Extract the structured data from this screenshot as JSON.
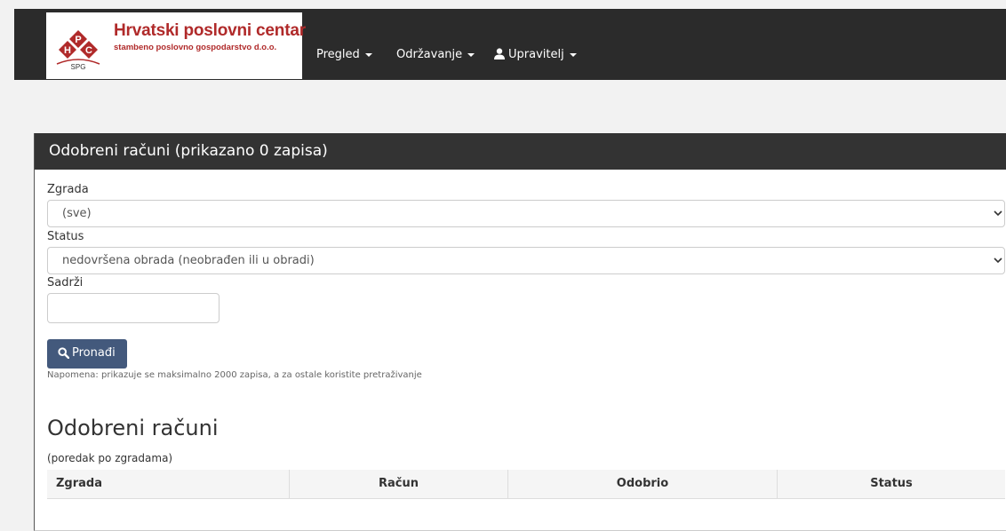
{
  "brand": {
    "logo_letters": [
      "H",
      "P",
      "C"
    ],
    "logo_sub": "SPG",
    "title": "Hrvatski poslovni centar",
    "subtitle": "stambeno poslovno gospodarstvo d.o.o."
  },
  "nav": {
    "items": [
      {
        "label": "Pregled",
        "icon": "caret-down-icon"
      },
      {
        "label": "Održavanje",
        "icon": "caret-down-icon"
      },
      {
        "label": "Upravitelj",
        "icon": "user-icon"
      }
    ]
  },
  "panel": {
    "title": "Odobreni računi (prikazano 0 zapisa)"
  },
  "filters": {
    "building_label": "Zgrada",
    "building_value": "(sve)",
    "status_label": "Status",
    "status_value": "nedovršena obrada (neobrađen ili u obradi)",
    "contains_label": "Sadrži",
    "contains_value": "",
    "search_button": "Pronađi",
    "note": "Napomena: prikazuje se maksimalno 2000 zapisa, a za ostale koristite pretraživanje"
  },
  "results": {
    "title": "Odobreni računi",
    "order_note": "(poredak po zgradama)",
    "columns": [
      "Zgrada",
      "Račun",
      "Odobrio",
      "Status"
    ],
    "rows": []
  },
  "colors": {
    "navbar": "#2b2b2b",
    "brand_red": "#b02a2a",
    "panel_heading": "#333333",
    "button": "#43597c"
  }
}
